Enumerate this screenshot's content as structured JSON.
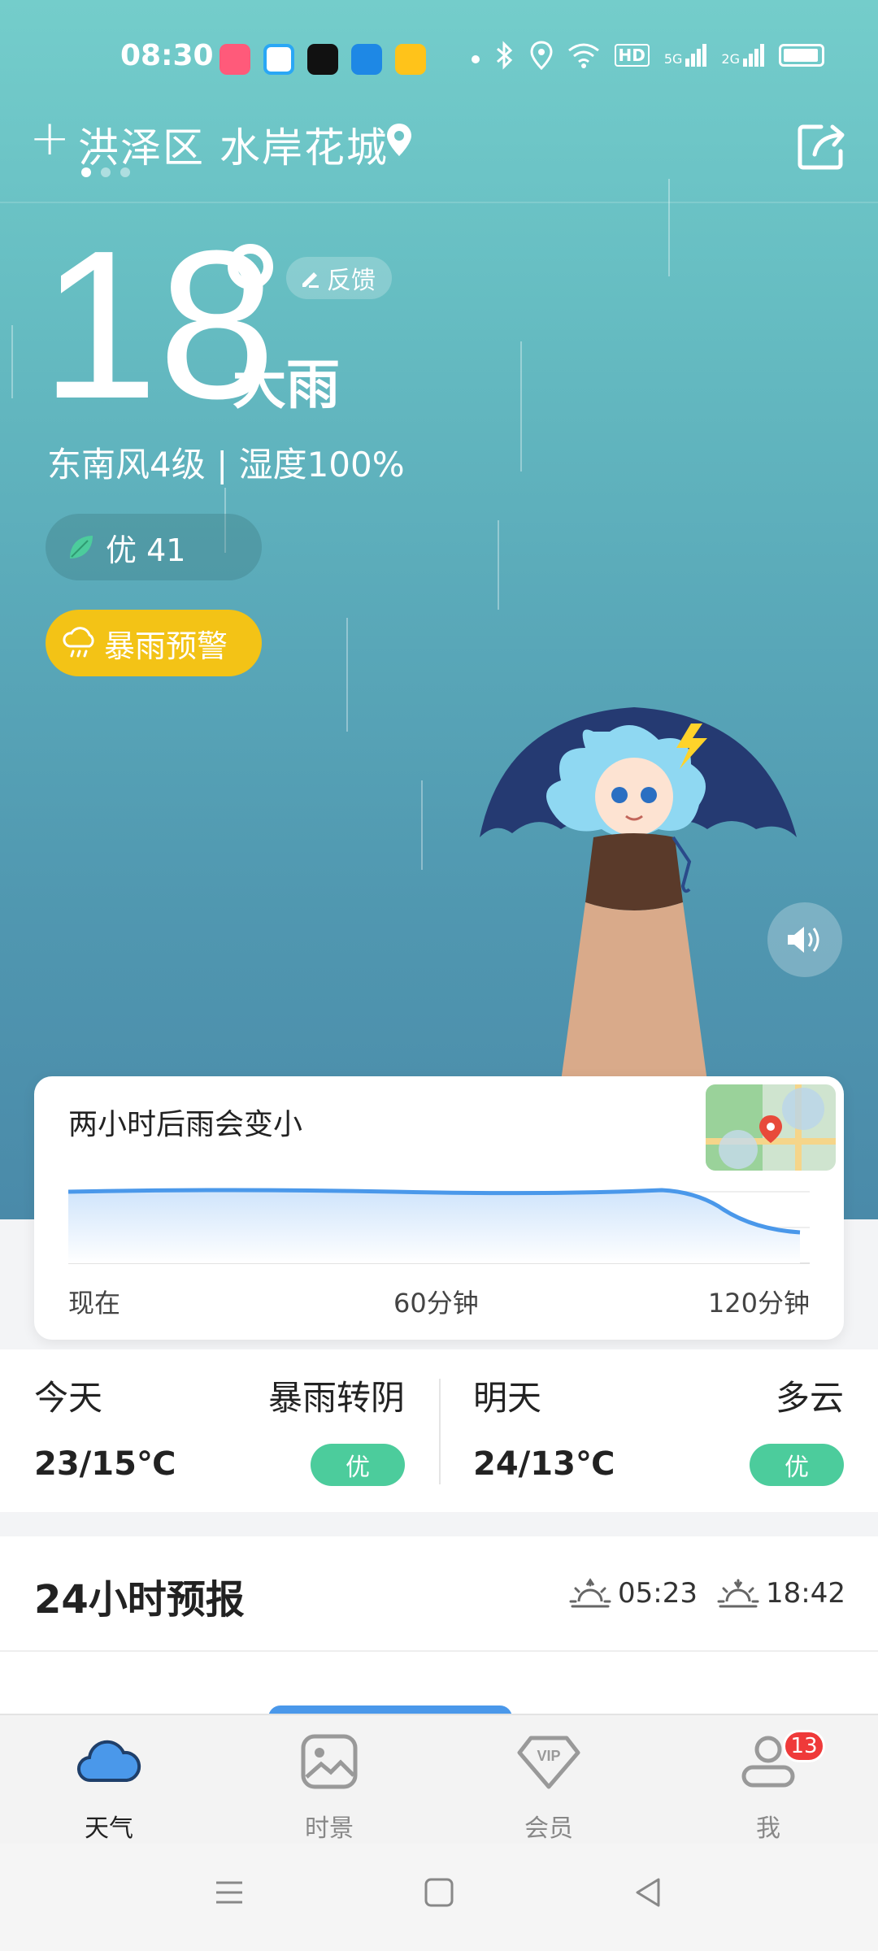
{
  "status_bar": {
    "time": "08:30",
    "app_icons": [
      "app-icon-1",
      "youku-icon",
      "tiktok-icon",
      "browser-icon",
      "weibo-icon"
    ],
    "indicators": [
      "bluetooth-icon",
      "location-icon",
      "wifi-icon",
      "hd-icon",
      "signal-5g-icon",
      "signal-2g-icon",
      "battery-icon"
    ],
    "hd_label": "HD",
    "net1": "5G",
    "net2": "2G"
  },
  "header": {
    "add_label": "+",
    "location": "洪泽区 水岸花城",
    "page_dots": 3,
    "active_dot": 0
  },
  "current": {
    "temperature": "18",
    "condition": "大雨",
    "feedback_label": "反馈",
    "wind_humidity": "东南风4级 | 湿度100%",
    "aqi_label": "优 41",
    "warning_label": "暴雨预警"
  },
  "rain_card": {
    "title": "两小时后雨会变小",
    "axis": [
      "现在",
      "60分钟",
      "120分钟"
    ]
  },
  "forecast": {
    "today": {
      "day": "今天",
      "condition": "暴雨转阴",
      "temp": "23/15℃",
      "aqi": "优"
    },
    "tomorrow": {
      "day": "明天",
      "condition": "多云",
      "temp": "24/13℃",
      "aqi": "优"
    }
  },
  "hours24": {
    "title": "24小时预报",
    "sunrise": "05:23",
    "sunset": "18:42"
  },
  "tabbar": {
    "tabs": [
      {
        "label": "天气",
        "icon": "cloud-icon",
        "active": true
      },
      {
        "label": "时景",
        "icon": "image-icon",
        "active": false
      },
      {
        "label": "会员",
        "icon": "vip-icon",
        "active": false
      },
      {
        "label": "我",
        "icon": "user-icon",
        "active": false
      }
    ],
    "me_badge": "13"
  },
  "colors": {
    "warning": "#f3c316",
    "aqi_good": "#4ccc9c",
    "accent_blue": "#4a98ea",
    "badge_red": "#ef3a3a"
  }
}
